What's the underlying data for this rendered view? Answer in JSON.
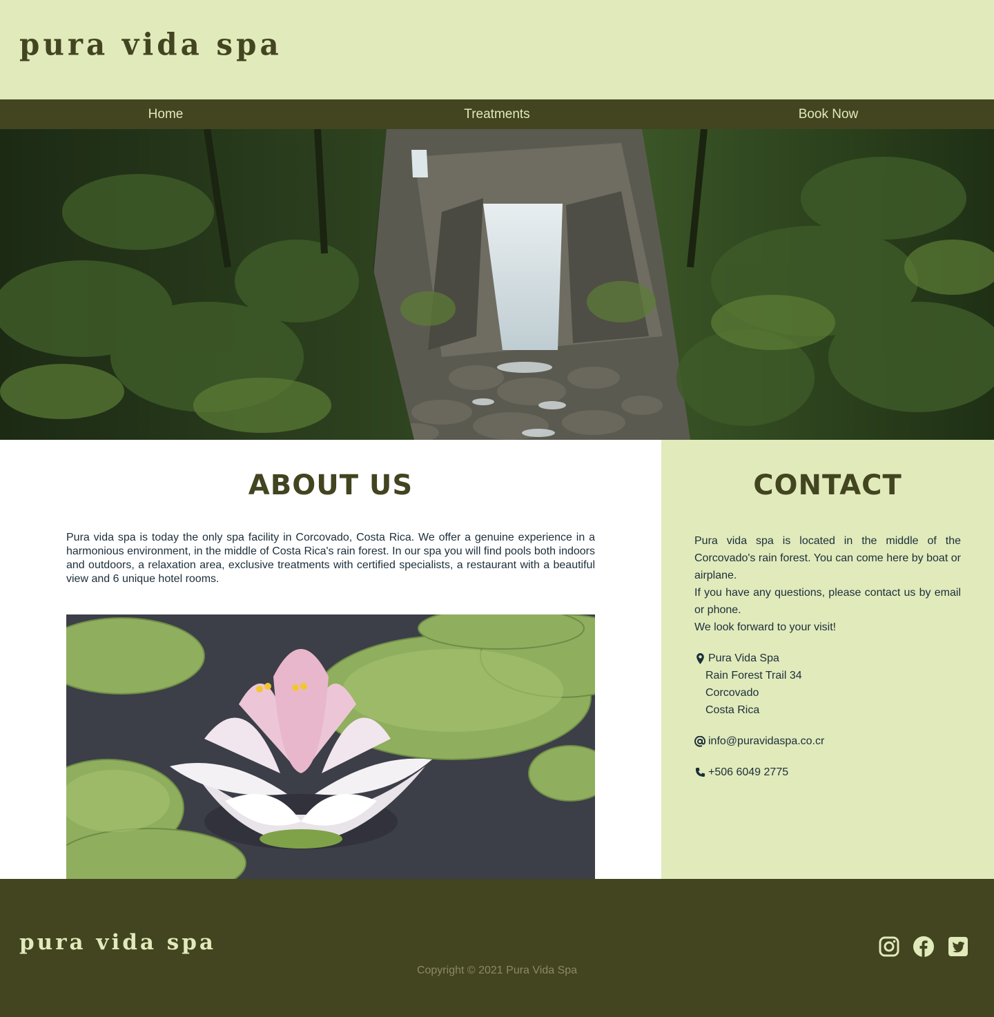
{
  "header": {
    "logo_text": "pura vida spa"
  },
  "nav": {
    "items": [
      {
        "label": "Home"
      },
      {
        "label": "Treatments"
      },
      {
        "label": "Book Now"
      }
    ]
  },
  "about": {
    "title": "ABOUT US",
    "body": "Pura vida spa is today the only spa facility in Corcovado, Costa Rica. We offer a genuine experience in a harmonious environment, in the middle of Costa Rica's rain forest. In our spa you will find pools both indoors and outdoors, a relaxation area, exclusive treatments with certified specialists, a restaurant with a beautiful view and 6 unique hotel rooms."
  },
  "contact": {
    "title": "CONTACT",
    "lines": [
      "Pura vida spa is located in the middle of the Corcovado's rain forest. You can come here by boat or airplane.",
      "If you have any questions, please contact us by email or phone.",
      "We look forward to your visit!"
    ],
    "address": {
      "name": "Pura Vida Spa",
      "street": "Rain Forest Trail 34",
      "city": "Corcovado",
      "country": "Costa Rica"
    },
    "email": "info@puravidaspa.co.cr",
    "phone": "+506 6049 2775"
  },
  "footer": {
    "logo_text": "pura vida spa",
    "copyright": "Copyright © 2021 Pura Vida Spa",
    "social": [
      {
        "icon": "instagram-icon"
      },
      {
        "icon": "facebook-icon"
      },
      {
        "icon": "twitter-icon"
      }
    ]
  },
  "colors": {
    "header_bg": "#e1eabb",
    "nav_bg": "#434420",
    "text_dark": "#1c2e3a",
    "accent_dark": "#434420"
  }
}
